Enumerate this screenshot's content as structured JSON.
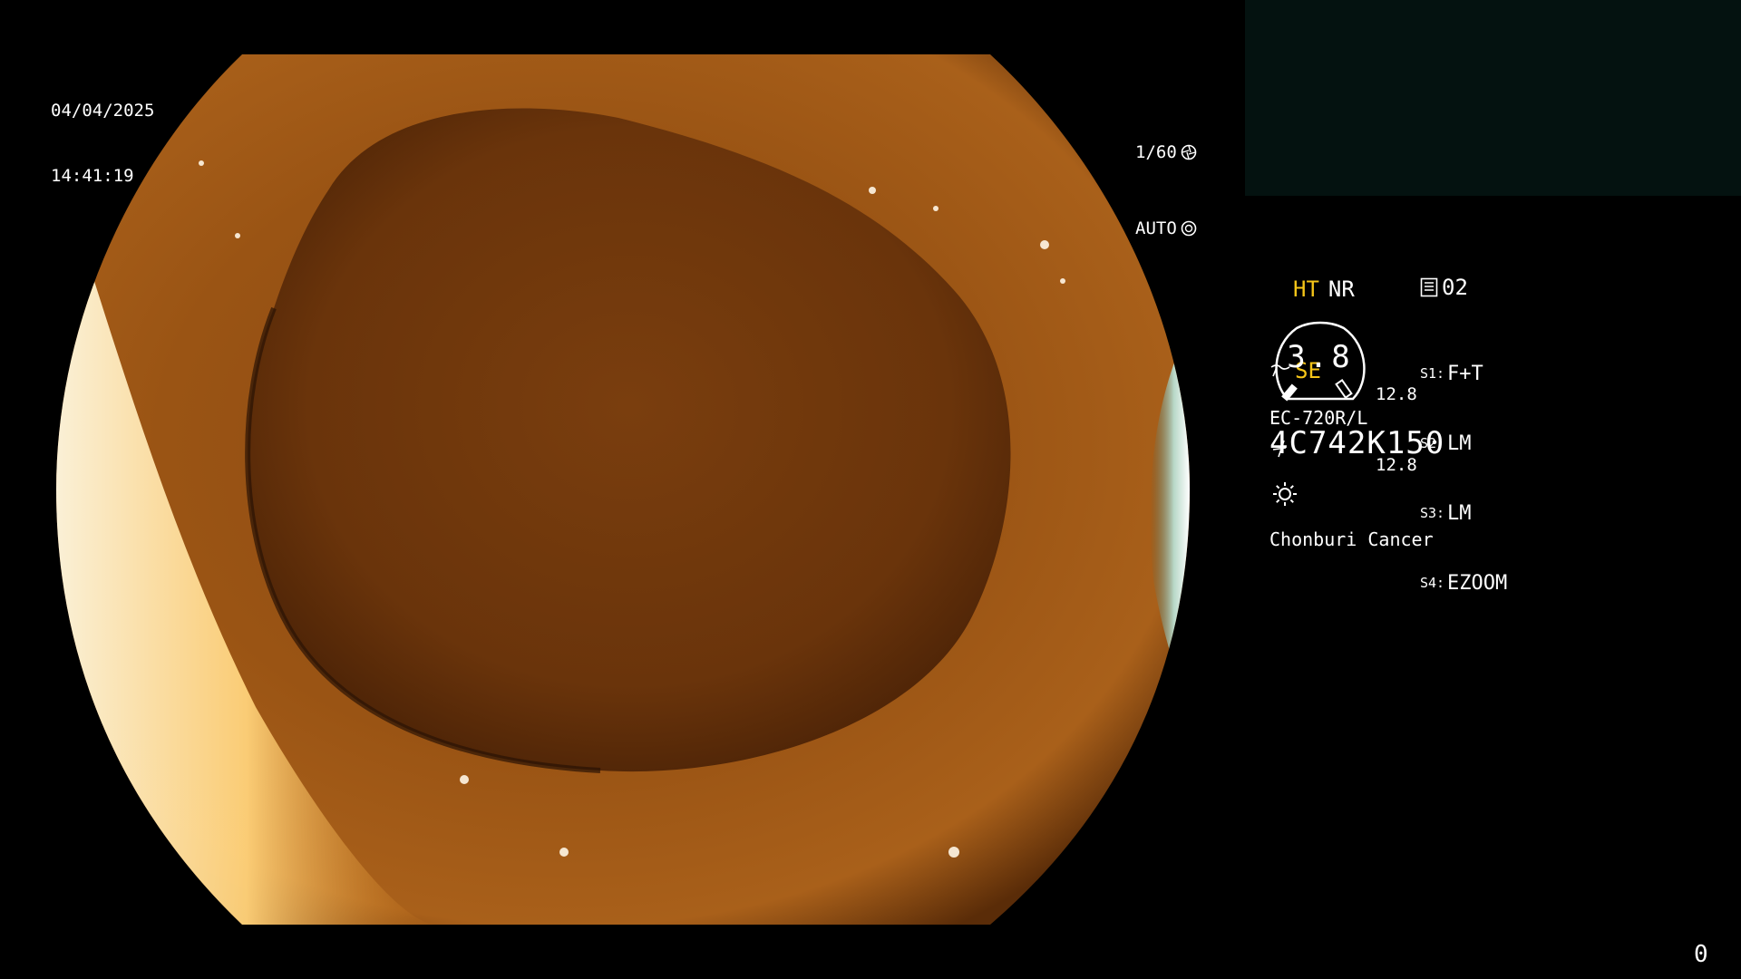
{
  "timestamp": {
    "date": "04/04/2025",
    "time": "14:41:19"
  },
  "exposure": {
    "shutter": "1/60",
    "shutter_icon": "aperture-icon",
    "mode": "AUTO",
    "mode_icon": "auto-iris-icon"
  },
  "enhancements": {
    "ht": "HT",
    "nr": "NR",
    "se": "SE",
    "se_icon": "structure-enhance-icon",
    "color_icon": "color-mode-icon"
  },
  "memory": {
    "icon": "memory-card-icon",
    "value": "02"
  },
  "gauge": {
    "value": "3.8",
    "left_top": "12.8",
    "left_bottom": "12.8"
  },
  "slots": [
    {
      "key": "S1:",
      "value": "F+T"
    },
    {
      "key": "S2:",
      "value": "LM"
    },
    {
      "key": "S3:",
      "value": "LM"
    },
    {
      "key": "S4:",
      "value": "EZOOM"
    }
  ],
  "scope": {
    "model": "EC-720R/L",
    "serial": "4C742K150"
  },
  "light_icon": "light-source-icon",
  "institution": "Chonburi Cancer",
  "frame_counter": "0",
  "colors": {
    "osd_text": "#ffffff",
    "osd_accent": "#f5c518",
    "background": "#000000",
    "preview_box": "#041210"
  }
}
